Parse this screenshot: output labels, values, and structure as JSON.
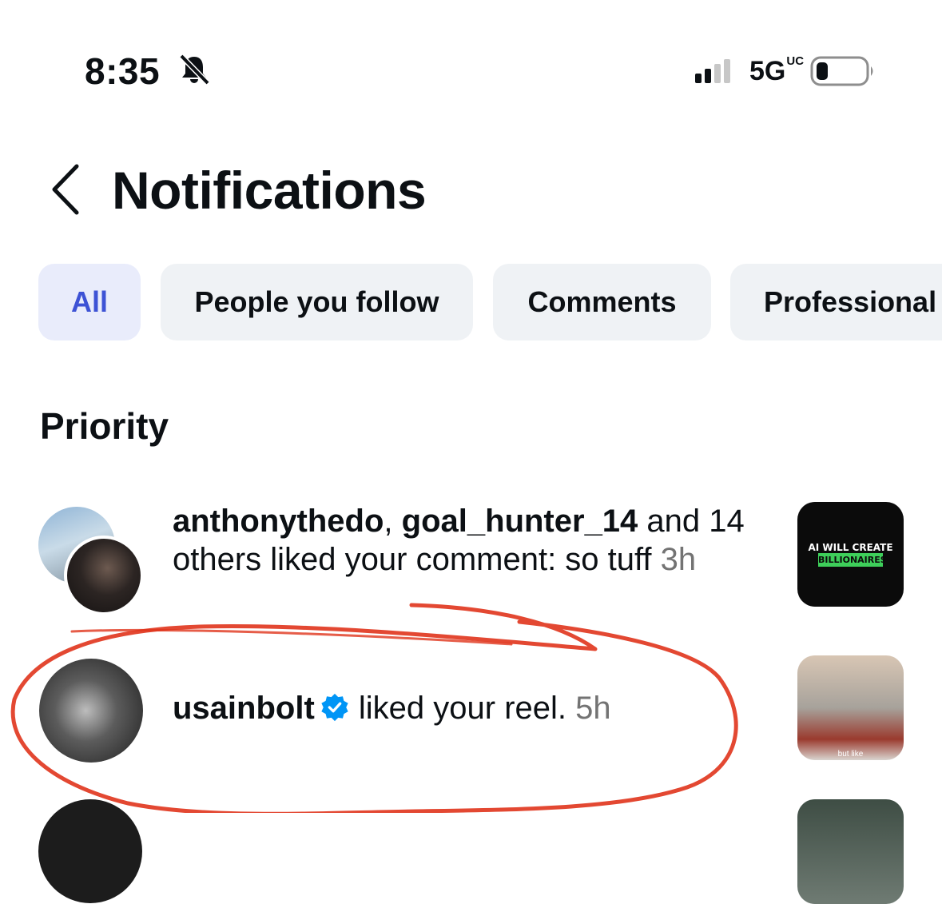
{
  "status_bar": {
    "time": "8:35",
    "network": "5G",
    "network_sub": "UC",
    "icons": [
      "bell-slash-icon",
      "signal-icon",
      "battery-icon"
    ]
  },
  "header": {
    "title": "Notifications",
    "back_icon": "chevron-left-icon"
  },
  "tabs": [
    {
      "label": "All",
      "active": true
    },
    {
      "label": "People you follow",
      "active": false
    },
    {
      "label": "Comments",
      "active": false
    },
    {
      "label": "Professional",
      "active": false
    }
  ],
  "section_title": "Priority",
  "notifications": [
    {
      "user1": "anthonythedo",
      "sep": ", ",
      "user2": "goal_hunter_14",
      "text": " and 14 others liked your comment: so tuff ",
      "time": "3h",
      "thumb_caption_1": "AI WILL CREATE",
      "thumb_caption_2": "BILLIONAIRES"
    },
    {
      "user": "usainbolt",
      "verified": true,
      "text": " liked your reel. ",
      "time": "5h",
      "thumb_caption": "but like"
    }
  ],
  "colors": {
    "accent": "#3d52d5",
    "active_tab_bg": "#e9ecfb",
    "tab_bg": "#eff2f5",
    "verified": "#0095f6",
    "annotation": "#e0341c"
  }
}
